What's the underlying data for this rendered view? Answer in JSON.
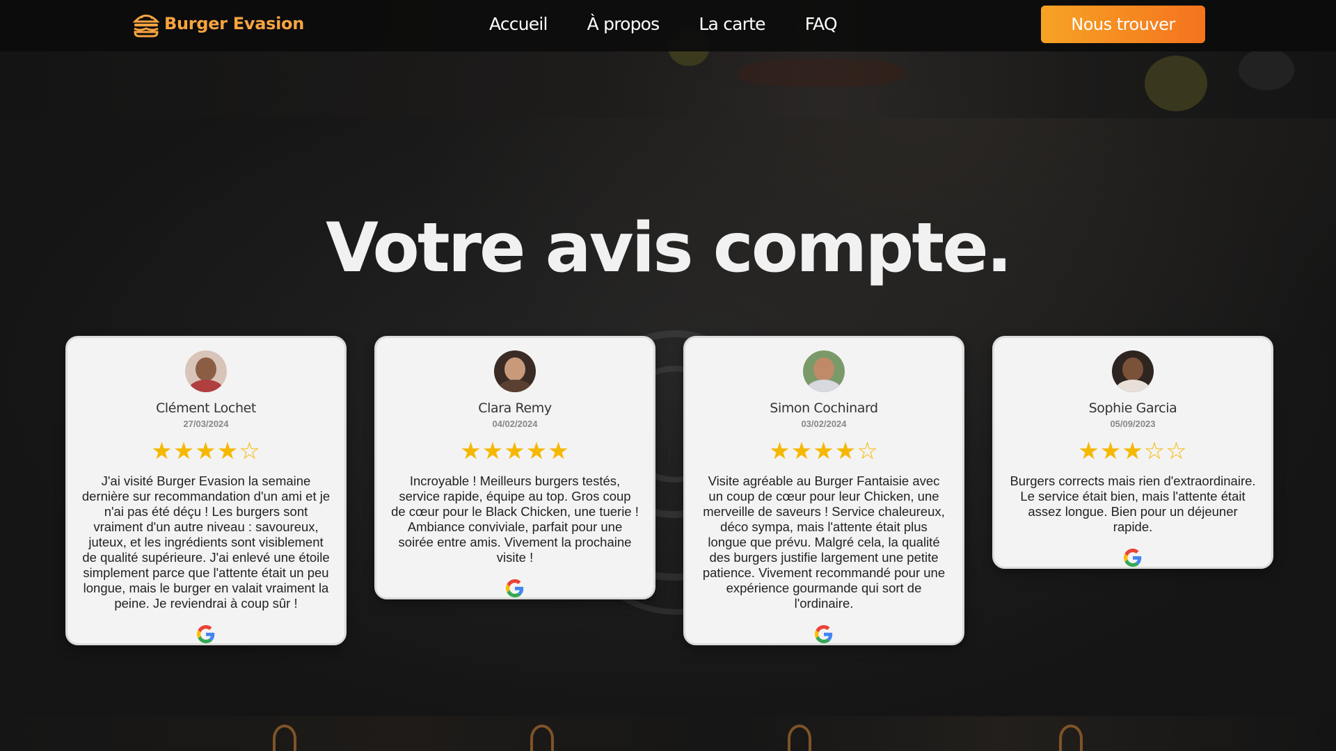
{
  "brand": {
    "name": "Burger Evasion",
    "color": "#f7a440"
  },
  "nav": {
    "links": [
      "Accueil",
      "À propos",
      "La carte",
      "FAQ"
    ],
    "cta_label": "Nous trouver"
  },
  "headline": "Votre avis compte.",
  "reviews": [
    {
      "name": "Clément Lochet",
      "date": "27/03/2024",
      "rating": 4,
      "stars": "★★★★☆",
      "text": "J'ai visité Burger Evasion la semaine dernière sur recommandation d'un ami et je n'ai pas été déçu ! Les burgers sont vraiment d'un autre niveau : savoureux, juteux, et les ingrédients sont visiblement de qualité supérieure. J'ai enlevé une étoile simplement parce que l'attente était un peu longue, mais le burger en valait vraiment la peine. Je reviendrai à coup sûr !",
      "source_icon": "google-icon"
    },
    {
      "name": "Clara Remy",
      "date": "04/02/2024",
      "rating": 5,
      "stars": "★★★★★",
      "text": "Incroyable ! Meilleurs burgers testés, service rapide, équipe au top. Gros coup de cœur pour le Black Chicken, une tuerie ! Ambiance conviviale, parfait pour une soirée entre amis. Vivement la prochaine visite !",
      "source_icon": "google-icon"
    },
    {
      "name": "Simon Cochinard",
      "date": "03/02/2024",
      "rating": 4,
      "stars": "★★★★☆",
      "text": "Visite agréable au Burger Fantaisie avec un coup de cœur pour leur Chicken, une merveille de saveurs ! Service chaleureux, déco sympa, mais l'attente était plus longue que prévu. Malgré cela, la qualité des burgers justifie largement une petite patience. Vivement recommandé pour une expérience gourmande qui sort de l'ordinaire.",
      "source_icon": "google-icon"
    },
    {
      "name": "Sophie Garcia",
      "date": "05/09/2023",
      "rating": 3,
      "stars": "★★★☆☆",
      "text": "Burgers corrects mais rien d'extraordinaire. Le service était bien, mais l'attente était assez longue. Bien pour un déjeuner rapide.",
      "source_icon": "google-icon"
    }
  ],
  "colors": {
    "accent_start": "#f6a324",
    "accent_end": "#f5731e",
    "star": "#f5b800",
    "card_bg": "#f3f3f3"
  }
}
